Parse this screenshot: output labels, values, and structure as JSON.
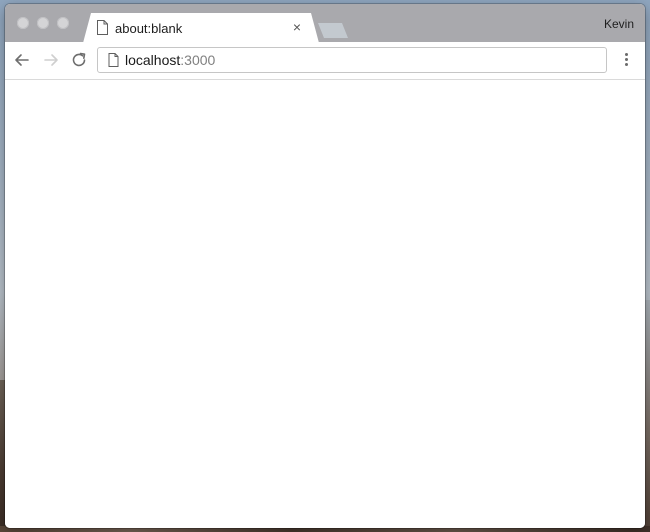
{
  "tabs": [
    {
      "title": "about:blank",
      "favicon": "document-icon",
      "close_glyph": "×"
    }
  ],
  "profile_name": "Kevin",
  "omnibox": {
    "host": "localhost",
    "rest": ":3000",
    "icon": "document-icon"
  },
  "colors": {
    "titlebar": "#a9a9ad",
    "tab_active": "#ffffff",
    "traffic_light_inactive": "#d4d4d6",
    "page_background": "#ffffff"
  }
}
